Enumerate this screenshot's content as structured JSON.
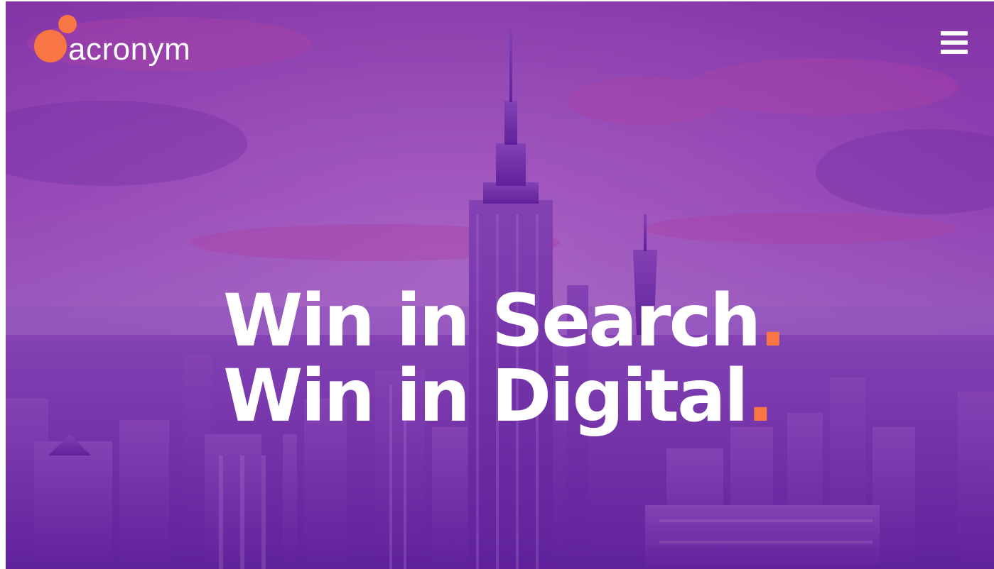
{
  "theme": {
    "accent": "#f77643",
    "overlay": "#7a36b0"
  },
  "header": {
    "logo": {
      "text": "acronym",
      "icon": "acronym-logo-dots"
    },
    "menu": {
      "icon": "hamburger-menu-icon"
    }
  },
  "hero": {
    "line1": "Win in Search",
    "line2": "Win in Digital",
    "punctuation": "."
  }
}
